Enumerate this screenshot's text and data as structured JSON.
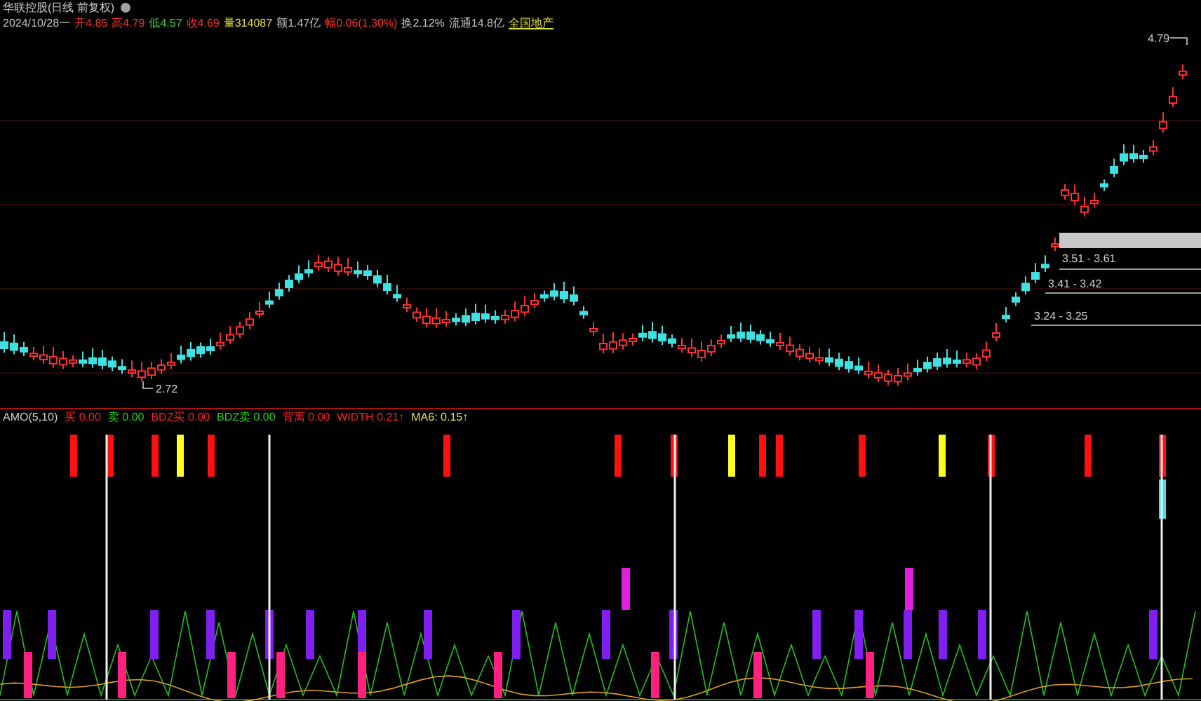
{
  "title": "华联控股(日线 前复权)",
  "quote": [
    {
      "label": "2024/10/28一",
      "color": "#c0c0c0"
    },
    {
      "label": "开",
      "value": "4.85",
      "color": "#ff3030"
    },
    {
      "label": "高",
      "value": "4.79",
      "color": "#ff3030"
    },
    {
      "label": "低",
      "value": "4.57",
      "color": "#30d030"
    },
    {
      "label": "收",
      "value": "4.69",
      "color": "#ff3030"
    },
    {
      "label": "量",
      "value": "314087",
      "color": "#e0e030"
    },
    {
      "label": "额",
      "value": "1.47亿",
      "color": "#c0c0c0"
    },
    {
      "label": "幅",
      "value": "0.06(1.30%)",
      "color": "#ff3030"
    },
    {
      "label": "换",
      "value": "2.12%",
      "color": "#c0c0c0"
    },
    {
      "label": "流通",
      "value": "14.8亿",
      "color": "#c0c0c0"
    }
  ],
  "sector": "全国地产",
  "price_labels": {
    "high": "4.79",
    "low": "2.72",
    "zones": [
      "3.51 - 3.61",
      "3.41 - 3.42",
      "3.24 - 3.25"
    ]
  },
  "indicator": {
    "name": "AMO(5,10)",
    "items": [
      {
        "label": "买",
        "value": "0.00",
        "color": "#ff2020"
      },
      {
        "label": "卖",
        "value": "0.00",
        "color": "#20d020"
      },
      {
        "label": "BDZ买",
        "value": "0.00",
        "color": "#ff2020"
      },
      {
        "label": "BDZ卖",
        "value": "0.00",
        "color": "#20d020"
      },
      {
        "label": "背离",
        "value": "0.00",
        "color": "#ff2020"
      },
      {
        "label": "WIDTH",
        "value": "0.21↑",
        "color": "#ff2020"
      },
      {
        "label": "MA6:",
        "value": "0.15↑",
        "color": "#e0e060"
      }
    ]
  }
}
